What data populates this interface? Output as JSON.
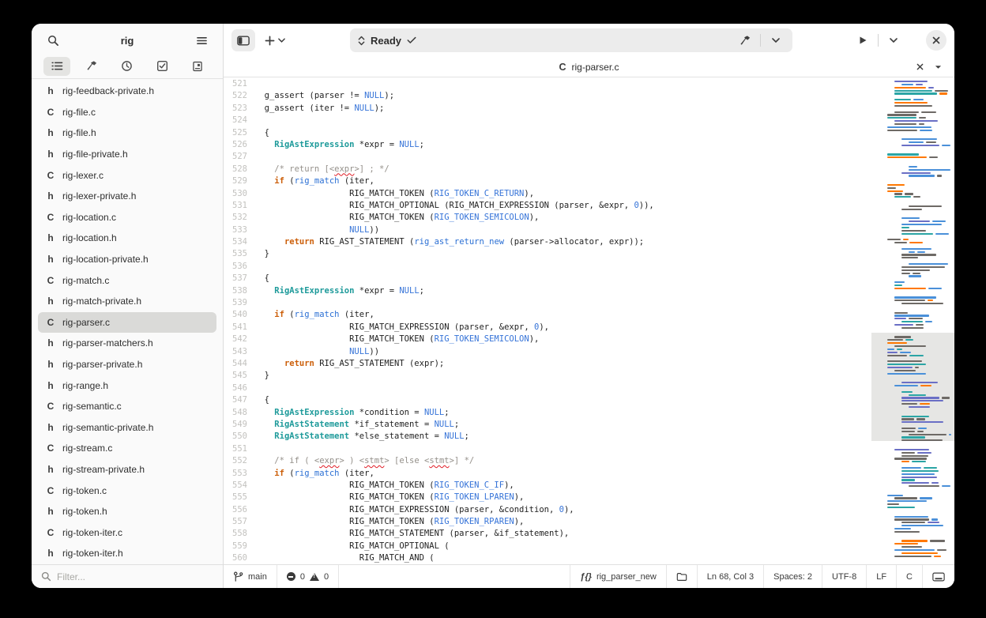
{
  "sidebar": {
    "title": "rig",
    "filter_placeholder": "Filter...",
    "tabs": [
      {
        "icon": "project-tree-icon",
        "selected": true
      },
      {
        "icon": "build-targets-icon",
        "selected": false
      },
      {
        "icon": "history-icon",
        "selected": false
      },
      {
        "icon": "todo-icon",
        "selected": false
      },
      {
        "icon": "documentation-icon",
        "selected": false
      }
    ],
    "files": [
      {
        "t": "h",
        "n": "rig-feedback-private.h",
        "sel": false
      },
      {
        "t": "C",
        "n": "rig-file.c",
        "sel": false
      },
      {
        "t": "h",
        "n": "rig-file.h",
        "sel": false
      },
      {
        "t": "h",
        "n": "rig-file-private.h",
        "sel": false
      },
      {
        "t": "C",
        "n": "rig-lexer.c",
        "sel": false
      },
      {
        "t": "h",
        "n": "rig-lexer-private.h",
        "sel": false
      },
      {
        "t": "C",
        "n": "rig-location.c",
        "sel": false
      },
      {
        "t": "h",
        "n": "rig-location.h",
        "sel": false
      },
      {
        "t": "h",
        "n": "rig-location-private.h",
        "sel": false
      },
      {
        "t": "C",
        "n": "rig-match.c",
        "sel": false
      },
      {
        "t": "h",
        "n": "rig-match-private.h",
        "sel": false
      },
      {
        "t": "C",
        "n": "rig-parser.c",
        "sel": true
      },
      {
        "t": "h",
        "n": "rig-parser-matchers.h",
        "sel": false
      },
      {
        "t": "h",
        "n": "rig-parser-private.h",
        "sel": false
      },
      {
        "t": "h",
        "n": "rig-range.h",
        "sel": false
      },
      {
        "t": "C",
        "n": "rig-semantic.c",
        "sel": false
      },
      {
        "t": "h",
        "n": "rig-semantic-private.h",
        "sel": false
      },
      {
        "t": "C",
        "n": "rig-stream.c",
        "sel": false
      },
      {
        "t": "h",
        "n": "rig-stream-private.h",
        "sel": false
      },
      {
        "t": "C",
        "n": "rig-token.c",
        "sel": false
      },
      {
        "t": "h",
        "n": "rig-token.h",
        "sel": false
      },
      {
        "t": "C",
        "n": "rig-token-iter.c",
        "sel": false
      },
      {
        "t": "h",
        "n": "rig-token-iter.h",
        "sel": false
      }
    ]
  },
  "header": {
    "status_text": "Ready"
  },
  "tabbar": {
    "file_lang": "C",
    "file_name": "rig-parser.c"
  },
  "statusbar": {
    "branch": "main",
    "errors": "0",
    "warnings": "0",
    "symbol": "rig_parser_new",
    "position": "Ln 68, Col 3",
    "spaces": "Spaces: 2",
    "encoding": "UTF-8",
    "line_ending": "LF",
    "language": "C"
  },
  "editor": {
    "syntax_colors": {
      "keyword": "#cc5f0a",
      "function": "#2a6fd4",
      "constant": "#3573d8",
      "type": "#1d9a9a",
      "comment": "#94908a",
      "line_number": "#c2c1be"
    },
    "lines": [
      {
        "n": "521",
        "segs": []
      },
      {
        "n": "522",
        "segs": [
          [
            "p",
            "  g_assert (parser != "
          ],
          [
            "c",
            "NULL"
          ],
          [
            "p",
            ");"
          ]
        ]
      },
      {
        "n": "523",
        "segs": [
          [
            "p",
            "  g_assert (iter != "
          ],
          [
            "c",
            "NULL"
          ],
          [
            "p",
            ");"
          ]
        ]
      },
      {
        "n": "524",
        "segs": []
      },
      {
        "n": "525",
        "segs": [
          [
            "p",
            "  {"
          ]
        ]
      },
      {
        "n": "526",
        "segs": [
          [
            "p",
            "    "
          ],
          [
            "t",
            "RigAstExpression"
          ],
          [
            "p",
            " *expr = "
          ],
          [
            "c",
            "NULL"
          ],
          [
            "p",
            ";"
          ]
        ]
      },
      {
        "n": "527",
        "segs": []
      },
      {
        "n": "528",
        "segs": [
          [
            "p",
            "    "
          ],
          [
            "m",
            "/* return [<"
          ],
          [
            "q",
            "expr"
          ],
          [
            "m",
            ">] ; */"
          ]
        ]
      },
      {
        "n": "529",
        "segs": [
          [
            "p",
            "    "
          ],
          [
            "k",
            "if"
          ],
          [
            "p",
            " ("
          ],
          [
            "f",
            "rig_match"
          ],
          [
            "p",
            " (iter,"
          ]
        ]
      },
      {
        "n": "530",
        "segs": [
          [
            "p",
            "                   RIG_MATCH_TOKEN ("
          ],
          [
            "c",
            "RIG_TOKEN_C_RETURN"
          ],
          [
            "p",
            "),"
          ]
        ]
      },
      {
        "n": "531",
        "segs": [
          [
            "p",
            "                   RIG_MATCH_OPTIONAL (RIG_MATCH_EXPRESSION (parser, &expr, "
          ],
          [
            "c",
            "0"
          ],
          [
            "p",
            ")),"
          ]
        ]
      },
      {
        "n": "532",
        "segs": [
          [
            "p",
            "                   RIG_MATCH_TOKEN ("
          ],
          [
            "c",
            "RIG_TOKEN_SEMICOLON"
          ],
          [
            "p",
            "),"
          ]
        ]
      },
      {
        "n": "533",
        "segs": [
          [
            "p",
            "                   "
          ],
          [
            "c",
            "NULL"
          ],
          [
            "p",
            "))"
          ]
        ]
      },
      {
        "n": "534",
        "segs": [
          [
            "p",
            "      "
          ],
          [
            "k",
            "return"
          ],
          [
            "p",
            " RIG_AST_STATEMENT ("
          ],
          [
            "f",
            "rig_ast_return_new"
          ],
          [
            "p",
            " (parser->allocator, expr));"
          ]
        ]
      },
      {
        "n": "535",
        "segs": [
          [
            "p",
            "  }"
          ]
        ]
      },
      {
        "n": "536",
        "segs": []
      },
      {
        "n": "537",
        "segs": [
          [
            "p",
            "  {"
          ]
        ]
      },
      {
        "n": "538",
        "segs": [
          [
            "p",
            "    "
          ],
          [
            "t",
            "RigAstExpression"
          ],
          [
            "p",
            " *expr = "
          ],
          [
            "c",
            "NULL"
          ],
          [
            "p",
            ";"
          ]
        ]
      },
      {
        "n": "539",
        "segs": []
      },
      {
        "n": "540",
        "segs": [
          [
            "p",
            "    "
          ],
          [
            "k",
            "if"
          ],
          [
            "p",
            " ("
          ],
          [
            "f",
            "rig_match"
          ],
          [
            "p",
            " (iter,"
          ]
        ]
      },
      {
        "n": "541",
        "segs": [
          [
            "p",
            "                   RIG_MATCH_EXPRESSION (parser, &expr, "
          ],
          [
            "c",
            "0"
          ],
          [
            "p",
            "),"
          ]
        ]
      },
      {
        "n": "542",
        "segs": [
          [
            "p",
            "                   RIG_MATCH_TOKEN ("
          ],
          [
            "c",
            "RIG_TOKEN_SEMICOLON"
          ],
          [
            "p",
            "),"
          ]
        ]
      },
      {
        "n": "543",
        "segs": [
          [
            "p",
            "                   "
          ],
          [
            "c",
            "NULL"
          ],
          [
            "p",
            "))"
          ]
        ]
      },
      {
        "n": "544",
        "segs": [
          [
            "p",
            "      "
          ],
          [
            "k",
            "return"
          ],
          [
            "p",
            " RIG_AST_STATEMENT (expr);"
          ]
        ]
      },
      {
        "n": "545",
        "segs": [
          [
            "p",
            "  }"
          ]
        ]
      },
      {
        "n": "546",
        "segs": []
      },
      {
        "n": "547",
        "segs": [
          [
            "p",
            "  {"
          ]
        ]
      },
      {
        "n": "548",
        "segs": [
          [
            "p",
            "    "
          ],
          [
            "t",
            "RigAstExpression"
          ],
          [
            "p",
            " *condition = "
          ],
          [
            "c",
            "NULL"
          ],
          [
            "p",
            ";"
          ]
        ]
      },
      {
        "n": "549",
        "segs": [
          [
            "p",
            "    "
          ],
          [
            "t",
            "RigAstStatement"
          ],
          [
            "p",
            " *if_statement = "
          ],
          [
            "c",
            "NULL"
          ],
          [
            "p",
            ";"
          ]
        ]
      },
      {
        "n": "550",
        "segs": [
          [
            "p",
            "    "
          ],
          [
            "t",
            "RigAstStatement"
          ],
          [
            "p",
            " *else_statement = "
          ],
          [
            "c",
            "NULL"
          ],
          [
            "p",
            ";"
          ]
        ]
      },
      {
        "n": "551",
        "segs": []
      },
      {
        "n": "552",
        "segs": [
          [
            "p",
            "    "
          ],
          [
            "m",
            "/* if ( <"
          ],
          [
            "q",
            "expr"
          ],
          [
            "m",
            "> ) <"
          ],
          [
            "q",
            "stmt"
          ],
          [
            "m",
            "> [else <"
          ],
          [
            "q",
            "stmt"
          ],
          [
            "m",
            ">] */"
          ]
        ]
      },
      {
        "n": "553",
        "segs": [
          [
            "p",
            "    "
          ],
          [
            "k",
            "if"
          ],
          [
            "p",
            " ("
          ],
          [
            "f",
            "rig_match"
          ],
          [
            "p",
            " (iter,"
          ]
        ]
      },
      {
        "n": "554",
        "segs": [
          [
            "p",
            "                   RIG_MATCH_TOKEN ("
          ],
          [
            "c",
            "RIG_TOKEN_C_IF"
          ],
          [
            "p",
            "),"
          ]
        ]
      },
      {
        "n": "555",
        "segs": [
          [
            "p",
            "                   RIG_MATCH_TOKEN ("
          ],
          [
            "c",
            "RIG_TOKEN_LPAREN"
          ],
          [
            "p",
            "),"
          ]
        ]
      },
      {
        "n": "556",
        "segs": [
          [
            "p",
            "                   RIG_MATCH_EXPRESSION (parser, &condition, "
          ],
          [
            "c",
            "0"
          ],
          [
            "p",
            "),"
          ]
        ]
      },
      {
        "n": "557",
        "segs": [
          [
            "p",
            "                   RIG_MATCH_TOKEN ("
          ],
          [
            "c",
            "RIG_TOKEN_RPAREN"
          ],
          [
            "p",
            "),"
          ]
        ]
      },
      {
        "n": "558",
        "segs": [
          [
            "p",
            "                   RIG_MATCH_STATEMENT (parser, &if_statement),"
          ]
        ]
      },
      {
        "n": "559",
        "segs": [
          [
            "p",
            "                   RIG_MATCH_OPTIONAL ("
          ]
        ]
      },
      {
        "n": "560",
        "segs": [
          [
            "p",
            "                     RIG_MATCH_AND ("
          ]
        ]
      }
    ]
  },
  "minimap": {
    "viewport_top_frac": 0.524,
    "viewport_height_frac": 0.222
  }
}
